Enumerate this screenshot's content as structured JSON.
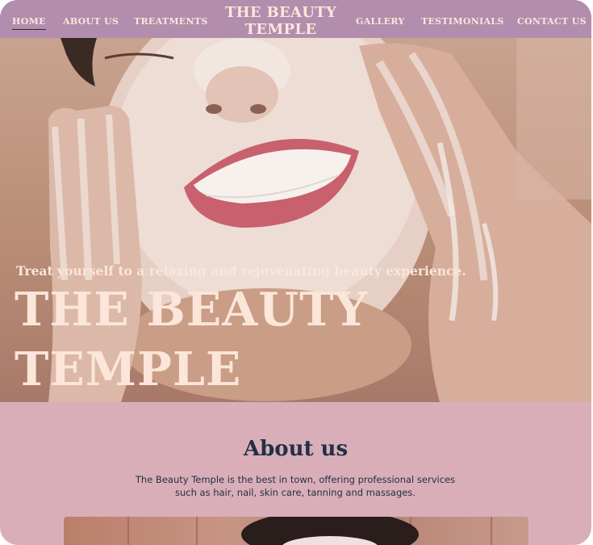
{
  "nav": {
    "left_items": [
      {
        "label": "HOME",
        "active": true
      },
      {
        "label": "ABOUT US",
        "active": false
      },
      {
        "label": "TREATMENTS",
        "active": false
      }
    ],
    "brand_line1": "THE BEAUTY",
    "brand_line2": "TEMPLE",
    "right_items": [
      {
        "label": "GALLERY",
        "active": false
      },
      {
        "label": "TESTIMONIALS",
        "active": false
      },
      {
        "label": "CONTACT US",
        "active": false
      }
    ]
  },
  "hero": {
    "tagline": "Treat yourself to a relaxing and rejuvenating beauty experience.",
    "title_line1": "THE BEAUTY",
    "title_line2": "TEMPLE"
  },
  "about": {
    "title": "About us",
    "text_line1": "The Beauty Temple is the best in town, offering professional services",
    "text_line2": "such as hair, nail, skin care, tanning and massages."
  },
  "colors": {
    "nav_bg": "#b28dad",
    "cream_text": "#fbe6d9",
    "about_bg": "#d9aeb8",
    "heading_navy": "#223045"
  }
}
